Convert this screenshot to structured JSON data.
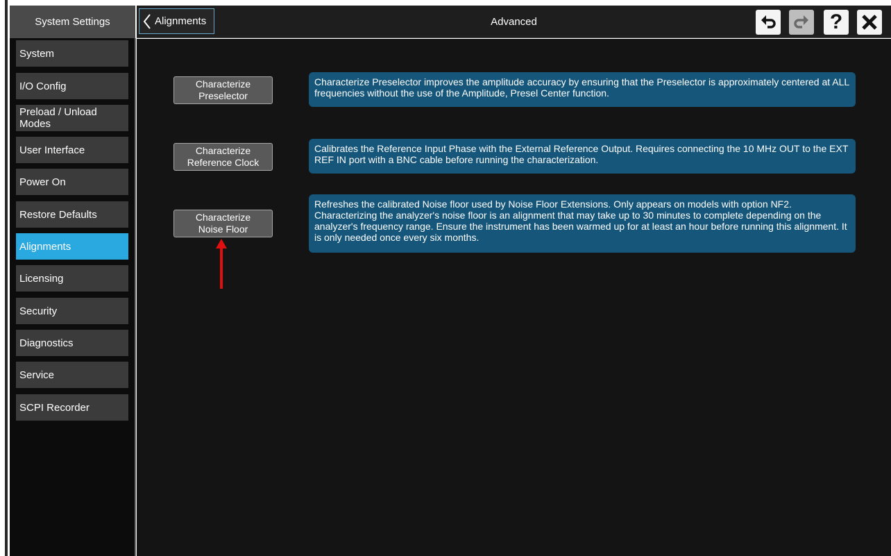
{
  "sidebar": {
    "header": "System Settings",
    "items": [
      {
        "label": "System",
        "active": false
      },
      {
        "label": "I/O Config",
        "active": false
      },
      {
        "label": "Preload / Unload Modes",
        "active": false
      },
      {
        "label": "User Interface",
        "active": false
      },
      {
        "label": "Power On",
        "active": false
      },
      {
        "label": "Restore Defaults",
        "active": false
      },
      {
        "label": "Alignments",
        "active": true
      },
      {
        "label": "Licensing",
        "active": false
      },
      {
        "label": "Security",
        "active": false
      },
      {
        "label": "Diagnostics",
        "active": false
      },
      {
        "label": "Service",
        "active": false
      },
      {
        "label": "SCPI Recorder",
        "active": false
      }
    ]
  },
  "topbar": {
    "back_label": "Alignments",
    "title": "Advanced",
    "icons": [
      "undo-icon",
      "redo-icon",
      "help-icon",
      "close-icon"
    ],
    "help_glyph": "?"
  },
  "main": {
    "rows": [
      {
        "button_line1": "Characterize",
        "button_line2": "Preselector",
        "description": "Characterize Preselector improves the amplitude accuracy by ensuring that the Preselector is approximately centered at ALL frequencies without the use of the Amplitude, Presel Center function."
      },
      {
        "button_line1": "Characterize",
        "button_line2": "Reference Clock",
        "description": "Calibrates the Reference Input Phase with the External Reference Output. Requires connecting the 10 MHz OUT to the EXT REF IN port with a BNC cable before running the characterization."
      },
      {
        "button_line1": "Characterize",
        "button_line2": "Noise Floor",
        "description": "Refreshes the calibrated Noise floor used by Noise Floor Extensions. Only appears on models with option NF2. Characterizing the analyzer's noise floor is an alignment that may take up to 30 minutes to complete depending on the analyzer's frequency range. Ensure the instrument has been warmed up for at least an hour before running this alignment. It is only needed once every six months."
      }
    ]
  },
  "colors": {
    "active_tab": "#2aa8e0",
    "description_bg": "#15567a",
    "annotation_arrow": "#e01010"
  }
}
